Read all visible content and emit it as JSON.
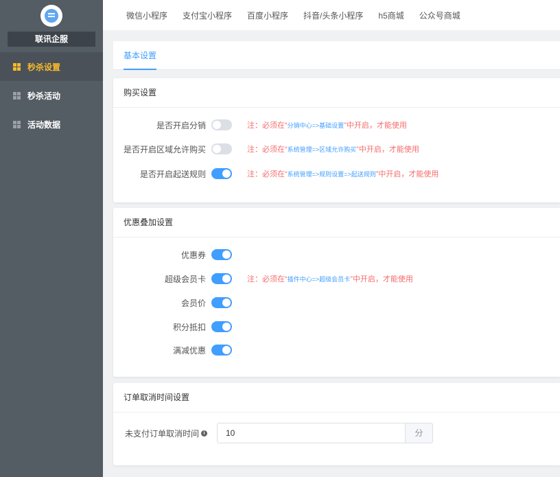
{
  "sidebar": {
    "brand": "联讯企服",
    "items": [
      {
        "label": "秒杀设置",
        "active": true
      },
      {
        "label": "秒杀活动",
        "active": false
      },
      {
        "label": "活动数据",
        "active": false
      }
    ]
  },
  "topnav": [
    "微信小程序",
    "支付宝小程序",
    "百度小程序",
    "抖音/头条小程序",
    "h5商城",
    "公众号商城"
  ],
  "tabs": {
    "basic": "基本设置"
  },
  "purchase": {
    "title": "购买设置",
    "rows": [
      {
        "label": "是否开启分销",
        "on": false,
        "note_pre": "注：必须在“",
        "note_link": "分销中心=>基础设置",
        "note_post": "”中开启，才能使用"
      },
      {
        "label": "是否开启区域允许购买",
        "on": false,
        "note_pre": "注：必须在“",
        "note_link": "系统管理=>区域允许购买",
        "note_post": "”中开启，才能使用"
      },
      {
        "label": "是否开启起送规则",
        "on": true,
        "note_pre": "注：必须在“",
        "note_link": "系统管理=>规则设置=>起送规则",
        "note_post": "”中开启，才能使用"
      }
    ]
  },
  "discount": {
    "title": "优惠叠加设置",
    "rows": [
      {
        "label": "优惠券",
        "on": true
      },
      {
        "label": "超级会员卡",
        "on": true,
        "note_pre": "注：必须在“",
        "note_link": "插件中心=>超级会员卡",
        "note_post": "”中开启，才能使用"
      },
      {
        "label": "会员价",
        "on": true
      },
      {
        "label": "积分抵扣",
        "on": true
      },
      {
        "label": "满减优惠",
        "on": true
      }
    ]
  },
  "cancel": {
    "title": "订单取消时间设置",
    "label": "未支付订单取消时间",
    "value": "10",
    "unit": "分"
  },
  "colors": {
    "accent": "#409eff",
    "warning": "#f56c6c",
    "sidebar": "#545c64",
    "active": "#f7ba2a"
  }
}
